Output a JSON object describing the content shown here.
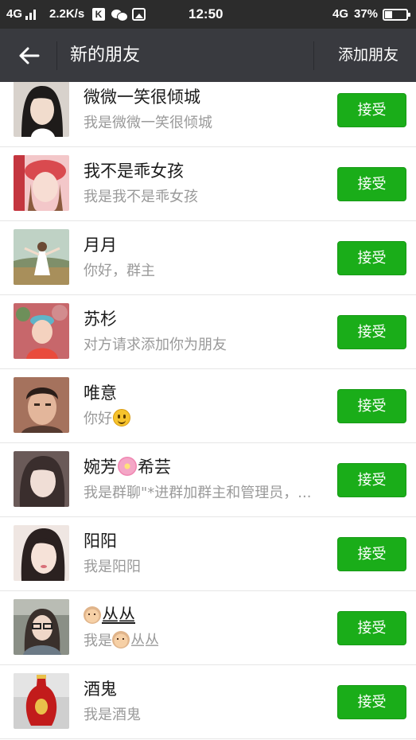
{
  "status_bar": {
    "network_left": "4G",
    "speed": "2.2K/s",
    "k_badge": "K",
    "time": "12:50",
    "network_right": "4G",
    "battery": "37%"
  },
  "top_bar": {
    "title": "新的朋友",
    "add_friend": "添加朋友",
    "back_icon": "arrow-left-icon"
  },
  "friend_requests": [
    {
      "name": "微微一笑很倾城",
      "message": "我是微微一笑很倾城",
      "button": "接受"
    },
    {
      "name": "我不是乖女孩",
      "message": "我是我不是乖女孩",
      "button": "接受"
    },
    {
      "name": "月月",
      "message": "你好，群主",
      "button": "接受"
    },
    {
      "name": "苏杉",
      "message": "对方请求添加你为朋友",
      "button": "接受"
    },
    {
      "name": "唯意",
      "message": "你好",
      "button": "接受"
    },
    {
      "name_pre": "婉芳",
      "name_post": "希芸",
      "message": "我是群聊\"*进群加群主和管理员，...",
      "button": "接受"
    },
    {
      "name": "阳阳",
      "message": "我是阳阳",
      "button": "接受"
    },
    {
      "name": "丛丛",
      "message_pre": "我是",
      "message_post": "丛丛",
      "button": "接受"
    },
    {
      "name": "酒鬼",
      "message": "我是酒鬼",
      "button": "接受"
    }
  ],
  "colors": {
    "accept_green": "#1aad19",
    "top_bar": "#393a3f",
    "status_bar": "#2c2c2c"
  }
}
